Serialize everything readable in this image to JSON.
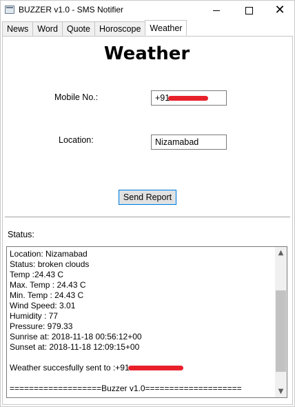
{
  "window": {
    "title": "BUZZER v1.0 - SMS Notifier",
    "minimize": "minimize",
    "maximize": "maximize",
    "close": "✕"
  },
  "tabs": [
    {
      "label": "News"
    },
    {
      "label": "Word"
    },
    {
      "label": "Quote"
    },
    {
      "label": "Horoscope"
    },
    {
      "label": "Weather",
      "active": true
    }
  ],
  "weather": {
    "heading": "Weather",
    "mobile_label": "Mobile No.:",
    "mobile_value": "+91",
    "location_label": "Location:",
    "location_value": "Nizamabad",
    "send_button": "Send Report",
    "status_label": "Status:",
    "status_lines": [
      "Location: Nizamabad",
      "Status: broken clouds",
      "Temp :24.43 C",
      "Max. Temp : 24.43 C",
      "Min. Temp : 24.43 C",
      "Wind Speed: 3.01",
      "Humidity : 77",
      "Pressure: 979.33",
      "Sunrise at: 2018-11-18 00:56:12+00",
      "Sunset at: 2018-11-18 12:09:15+00",
      "",
      "Weather succesfully sent to :+91",
      "",
      "===================Buzzer v1.0===================="
    ]
  },
  "icons": {
    "app": "app-window-icon",
    "scroll_up": "▲",
    "scroll_down": "▼"
  }
}
